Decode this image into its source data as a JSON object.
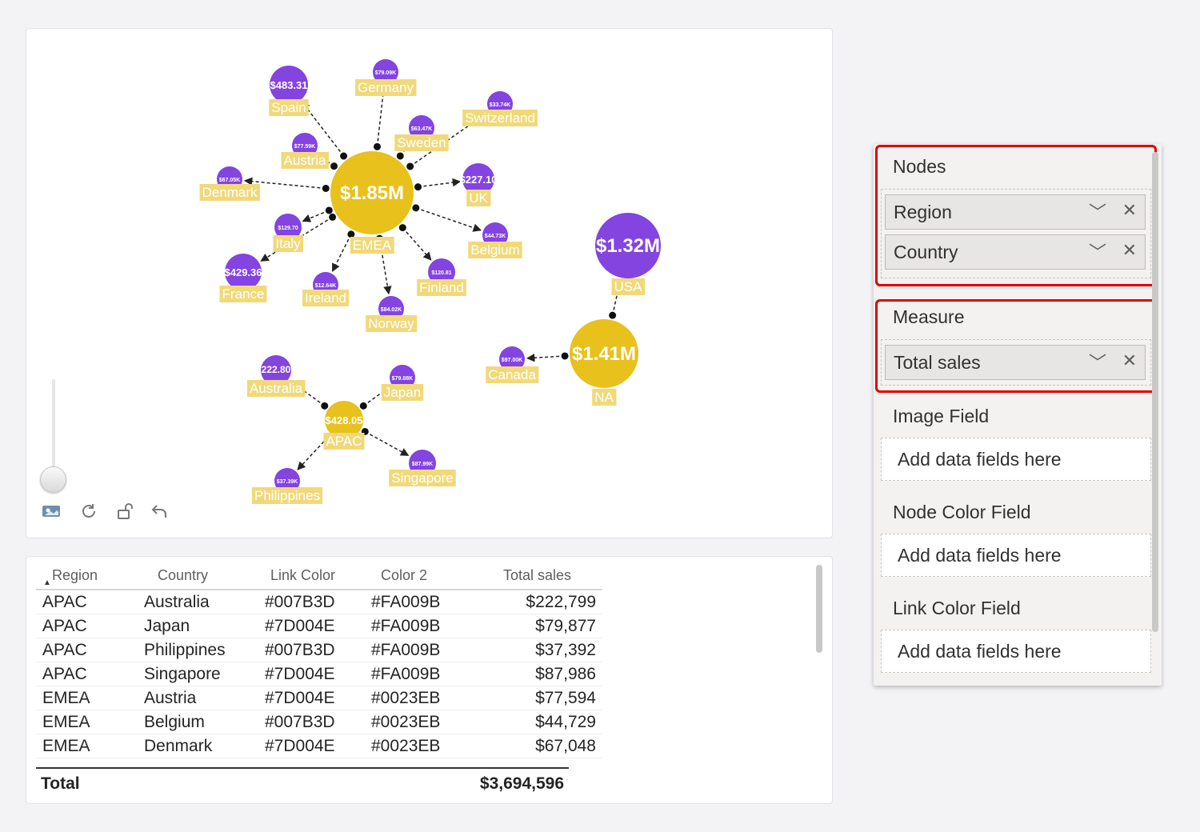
{
  "graph": {
    "nodes": [
      {
        "id": "EMEA",
        "label": "EMEA",
        "value_label": "$1.85M",
        "type": "region"
      },
      {
        "id": "NA",
        "label": "NA",
        "value_label": "$1.41M",
        "type": "region"
      },
      {
        "id": "APAC",
        "label": "APAC",
        "value_label": "$428.05",
        "type": "region"
      },
      {
        "id": "USA",
        "label": "USA",
        "value_label": "$1.32M",
        "type": "country"
      },
      {
        "id": "Canada",
        "label": "Canada",
        "value_label": "$97.00K",
        "type": "country"
      },
      {
        "id": "Spain",
        "label": "Spain",
        "value_label": "$483.31",
        "type": "country"
      },
      {
        "id": "Germany",
        "label": "Germany",
        "value_label": "$79.09K",
        "type": "country"
      },
      {
        "id": "Switzerland",
        "label": "Switzerland",
        "value_label": "$33.74K",
        "type": "country"
      },
      {
        "id": "Sweden",
        "label": "Sweden",
        "value_label": "$63.47K",
        "type": "country"
      },
      {
        "id": "Austria",
        "label": "Austria",
        "value_label": "$77.59K",
        "type": "country"
      },
      {
        "id": "Denmark",
        "label": "Denmark",
        "value_label": "$67.05K",
        "type": "country"
      },
      {
        "id": "UK",
        "label": "UK",
        "value_label": "$227.10",
        "type": "country"
      },
      {
        "id": "Italy",
        "label": "Italy",
        "value_label": "$129.70",
        "type": "country"
      },
      {
        "id": "Belgium",
        "label": "Belgium",
        "value_label": "$44.73K",
        "type": "country"
      },
      {
        "id": "France",
        "label": "France",
        "value_label": "$429.36",
        "type": "country"
      },
      {
        "id": "Ireland",
        "label": "Ireland",
        "value_label": "$12.64K",
        "type": "country"
      },
      {
        "id": "Finland",
        "label": "Finland",
        "value_label": "$120.81",
        "type": "country"
      },
      {
        "id": "Norway",
        "label": "Norway",
        "value_label": "$84.02K",
        "type": "country"
      },
      {
        "id": "Australia",
        "label": "Australia",
        "value_label": "222.80",
        "type": "country"
      },
      {
        "id": "Japan",
        "label": "Japan",
        "value_label": "$79.88K",
        "type": "country"
      },
      {
        "id": "Philippines",
        "label": "Philippines",
        "value_label": "$37.39K",
        "type": "country"
      },
      {
        "id": "Singapore",
        "label": "Singapore",
        "value_label": "$87.99K",
        "type": "country"
      }
    ],
    "links": [
      [
        "EMEA",
        "Spain"
      ],
      [
        "EMEA",
        "Germany"
      ],
      [
        "EMEA",
        "Switzerland"
      ],
      [
        "EMEA",
        "Sweden"
      ],
      [
        "EMEA",
        "Austria"
      ],
      [
        "EMEA",
        "Denmark"
      ],
      [
        "EMEA",
        "UK"
      ],
      [
        "EMEA",
        "Italy"
      ],
      [
        "EMEA",
        "Belgium"
      ],
      [
        "EMEA",
        "France"
      ],
      [
        "EMEA",
        "Ireland"
      ],
      [
        "EMEA",
        "Finland"
      ],
      [
        "EMEA",
        "Norway"
      ],
      [
        "NA",
        "USA"
      ],
      [
        "NA",
        "Canada"
      ],
      [
        "APAC",
        "Australia"
      ],
      [
        "APAC",
        "Japan"
      ],
      [
        "APAC",
        "Philippines"
      ],
      [
        "APAC",
        "Singapore"
      ]
    ],
    "colors": {
      "region": "#E8C11C",
      "country": "#8344E0",
      "label_bg": "#F1D97A"
    }
  },
  "toolbar": {
    "icons": [
      "image-icon",
      "refresh-icon",
      "unlock-icon",
      "undo-icon"
    ]
  },
  "table": {
    "headers": [
      "Region",
      "Country",
      "Link Color",
      "Color 2",
      "Total sales"
    ],
    "rows": [
      [
        "APAC",
        "Australia",
        "#007B3D",
        "#FA009B",
        "$222,799"
      ],
      [
        "APAC",
        "Japan",
        "#7D004E",
        "#FA009B",
        "$79,877"
      ],
      [
        "APAC",
        "Philippines",
        "#007B3D",
        "#FA009B",
        "$37,392"
      ],
      [
        "APAC",
        "Singapore",
        "#7D004E",
        "#FA009B",
        "$87,986"
      ],
      [
        "EMEA",
        "Austria",
        "#7D004E",
        "#0023EB",
        "$77,594"
      ],
      [
        "EMEA",
        "Belgium",
        "#007B3D",
        "#0023EB",
        "$44,729"
      ],
      [
        "EMEA",
        "Denmark",
        "#7D004E",
        "#0023EB",
        "$67,048"
      ]
    ],
    "total_label": "Total",
    "total_value": "$3,694,596"
  },
  "fields": {
    "nodes_label": "Nodes",
    "nodes_items": [
      "Region",
      "Country"
    ],
    "measure_label": "Measure",
    "measure_items": [
      "Total sales"
    ],
    "image_label": "Image Field",
    "node_color_label": "Node Color Field",
    "link_color_label": "Link Color Field",
    "placeholder": "Add data fields here"
  }
}
